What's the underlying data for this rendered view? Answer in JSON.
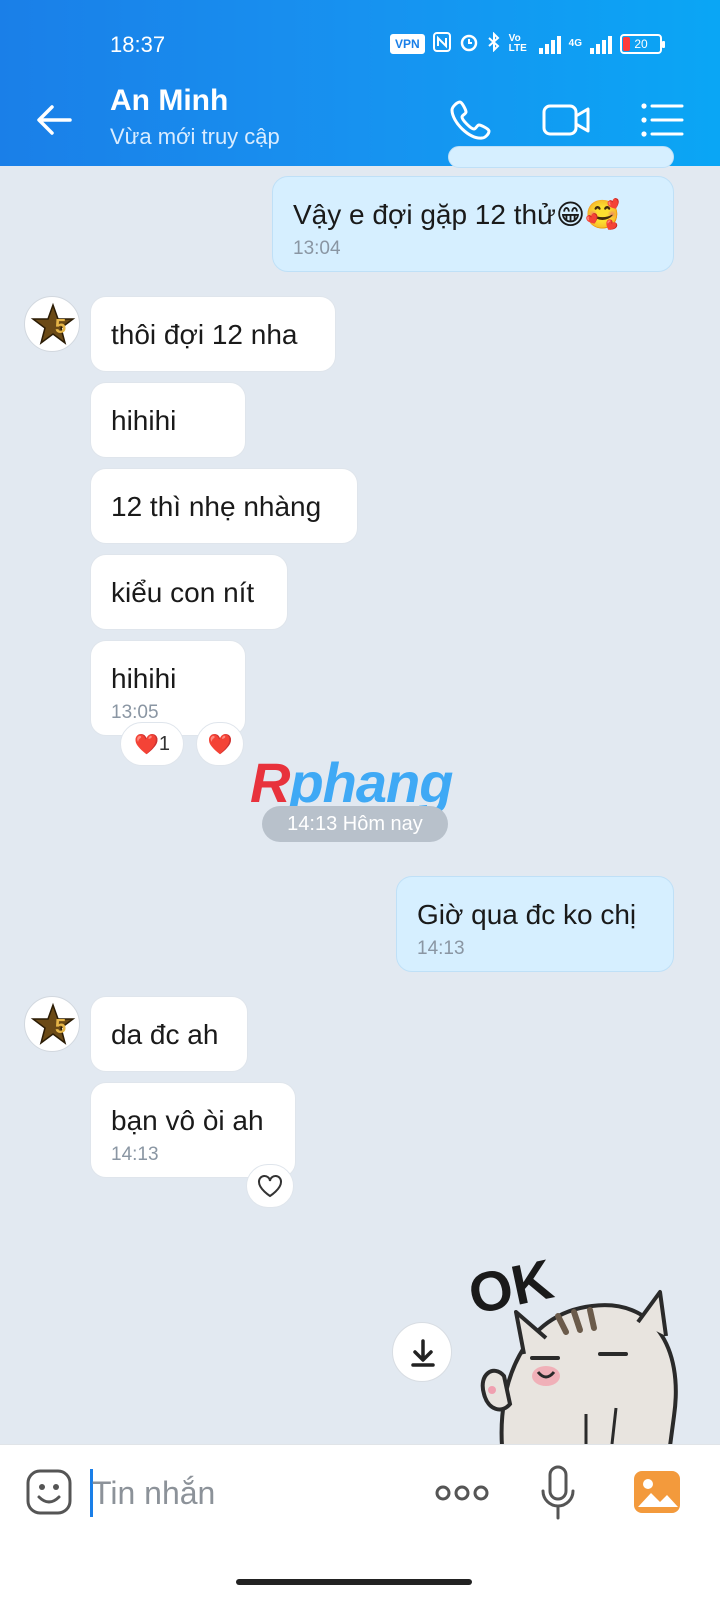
{
  "status_bar": {
    "time": "18:37",
    "vpn": "VPN",
    "network_label": "4G",
    "volte_label": "Vo LTE",
    "battery": "20"
  },
  "header": {
    "name": "An Minh",
    "status": "Vừa mới truy cập",
    "back_icon": "arrow-left-icon",
    "call_icon": "phone-icon",
    "video_icon": "video-camera-icon",
    "menu_icon": "list-menu-icon",
    "accent_color": "#1a7fe8"
  },
  "messages": [
    {
      "side": "out",
      "text": "Vậy e đợi gặp 12 thử😁🥰",
      "time": "13:04"
    },
    {
      "side": "in",
      "text": "thôi đợi 12 nha"
    },
    {
      "side": "in",
      "text": "hihihi"
    },
    {
      "side": "in",
      "text": "12 thì nhẹ nhàng"
    },
    {
      "side": "in",
      "text": "kiểu con nít"
    },
    {
      "side": "in",
      "text": "hihihi",
      "time": "13:05",
      "reaction_count": "1"
    },
    {
      "side": "out",
      "text": "Giờ qua đc ko chị",
      "time": "14:13"
    },
    {
      "side": "in",
      "text": "da đc ah"
    },
    {
      "side": "in",
      "text": "bạn vô òi ah",
      "time": "14:13"
    }
  ],
  "reactions": {
    "heart_emoji": "❤️",
    "count": "1"
  },
  "divider": "14:13 Hôm nay",
  "watermark": {
    "first": "R",
    "rest": "phang"
  },
  "sticker": {
    "text": "OK",
    "icon": "cat-ok-sticker"
  },
  "input": {
    "placeholder": "Tin nhắn",
    "emoji_icon": "emoji-icon",
    "more_icon": "more-dots-icon",
    "mic_icon": "microphone-icon",
    "image_icon": "image-gallery-icon"
  }
}
